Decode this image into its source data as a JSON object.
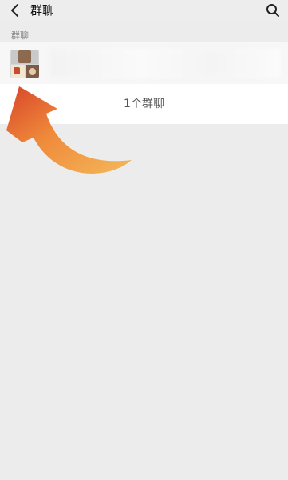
{
  "header": {
    "title": "群聊",
    "back_icon": "chevron-left-icon",
    "search_icon": "search-icon"
  },
  "section": {
    "label": "群聊"
  },
  "group_list": {
    "count_text": "1个群聊"
  },
  "colors": {
    "arrow_start": "#f4b85a",
    "arrow_end": "#d8452a",
    "background": "#ececec"
  }
}
